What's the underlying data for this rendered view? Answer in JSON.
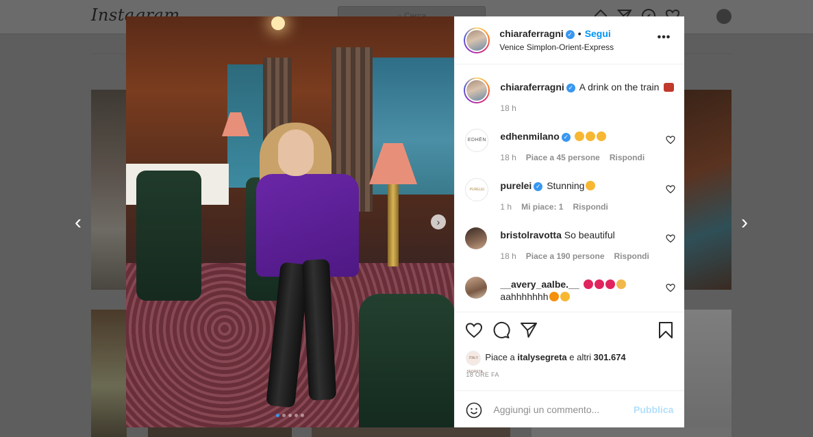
{
  "background": {
    "logo": "Instagram",
    "search_placeholder": "Cerca"
  },
  "post": {
    "author": "chiaraferragni",
    "follow_label": "Segui",
    "separator": "•",
    "location": "Venice Simplon-Orient-Express",
    "more_label": "•••",
    "caption": "A drink on the train",
    "caption_time": "18 h",
    "image_count": 5,
    "active_image": 1,
    "comments": [
      {
        "user": "edhenmilano",
        "verified": true,
        "text": "",
        "emojis": [
          "heart-eyes",
          "heart-eyes",
          "heart-eyes"
        ],
        "time": "18 h",
        "likes": "Piace a 45 persone",
        "reply": "Rispondi",
        "avatar_text": "EDHĒN"
      },
      {
        "user": "purelei",
        "verified": true,
        "text": "Stunning",
        "emojis": [
          "heart-eyes"
        ],
        "time": "1 h",
        "likes": "Mi piace: 1",
        "reply": "Rispondi",
        "avatar_text": "PURELEI"
      },
      {
        "user": "bristolravotta",
        "verified": false,
        "text": "So beautiful",
        "emojis": [],
        "time": "18 h",
        "likes": "Piace a 190 persone",
        "reply": "Rispondi",
        "avatar_text": ""
      },
      {
        "user": "__avery_aalbe.__",
        "verified": false,
        "text": "",
        "emojis": [
          "red-heart",
          "red-heart",
          "red-heart",
          "raised-hands"
        ],
        "text2": "aahhhhhhh",
        "emojis2": [
          "fire",
          "astonished"
        ],
        "avatar_text": ""
      }
    ],
    "likes_prefix": "Piace a ",
    "likes_user": "italysegreta",
    "likes_middle": " e altri ",
    "likes_count": "301.674",
    "likes_avatar_text": "ITALY SEGRETA",
    "timestamp": "18 ORE FA",
    "comment_placeholder": "Aggiungi un commento...",
    "publish_label": "Pubblica"
  },
  "colors": {
    "accent": "#0095f6",
    "verified": "#3897f0",
    "muted": "#8e8e8e",
    "publish_disabled": "#b2dffc"
  }
}
